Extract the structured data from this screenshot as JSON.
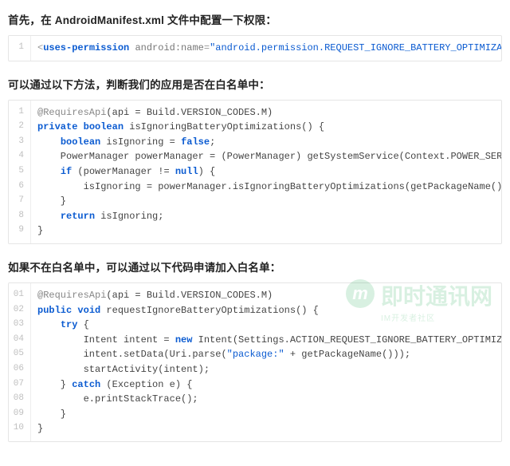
{
  "heading1": {
    "pre": "首先，在 ",
    "bold": "AndroidManifest.xml",
    "post": " 文件中配置一下权限："
  },
  "code1": {
    "lines": [
      {
        "n": "1",
        "html": "<span class='p'>&lt;</span><span class='k'>uses-permission</span> <span class='a'>android:name</span><span class='p'>=</span><span class='s'>\"android.permission.REQUEST_IGNORE_BATTERY_OPTIMIZATIONS\"</span> <span class='p'>/&gt;</span>"
      }
    ]
  },
  "heading2": "可以通过以下方法，判断我们的应用是否在白名单中：",
  "code2": {
    "lines": [
      {
        "n": "1",
        "html": "<span class='anno'>@RequiresApi</span>(api = Build.VERSION_CODES.M)"
      },
      {
        "n": "2",
        "html": "<span class='k'>private</span> <span class='k'>boolean</span> isIgnoringBatteryOptimizations() {"
      },
      {
        "n": "3",
        "html": "    <span class='k'>boolean</span> isIgnoring = <span class='k'>false</span>;"
      },
      {
        "n": "4",
        "html": "    PowerManager powerManager = (PowerManager) getSystemService(Context.POWER_SERVICE);"
      },
      {
        "n": "5",
        "html": "    <span class='k'>if</span> (powerManager != <span class='k'>null</span>) {"
      },
      {
        "n": "6",
        "html": "        isIgnoring = powerManager.isIgnoringBatteryOptimizations(getPackageName());"
      },
      {
        "n": "7",
        "html": "    }"
      },
      {
        "n": "8",
        "html": "    <span class='k'>return</span> isIgnoring;"
      },
      {
        "n": "9",
        "html": "}"
      }
    ]
  },
  "heading3": "如果不在白名单中，可以通过以下代码申请加入白名单：",
  "code3": {
    "lines": [
      {
        "n": "01",
        "html": "<span class='anno'>@RequiresApi</span>(api = Build.VERSION_CODES.M)"
      },
      {
        "n": "02",
        "html": "<span class='k'>public</span> <span class='k'>void</span> requestIgnoreBatteryOptimizations() {"
      },
      {
        "n": "03",
        "html": "    <span class='k'>try</span> {"
      },
      {
        "n": "04",
        "html": "        Intent intent = <span class='k'>new</span> Intent(Settings.ACTION_REQUEST_IGNORE_BATTERY_OPTIMIZATIONS);"
      },
      {
        "n": "05",
        "html": "        intent.setData(Uri.parse(<span class='s'>\"package:\"</span> + getPackageName()));"
      },
      {
        "n": "06",
        "html": "        startActivity(intent);"
      },
      {
        "n": "07",
        "html": "    } <span class='k'>catch</span> (Exception e) {"
      },
      {
        "n": "08",
        "html": "        e.printStackTrace();"
      },
      {
        "n": "09",
        "html": "    }"
      },
      {
        "n": "10",
        "html": "}"
      }
    ]
  },
  "watermark": {
    "icon": "m",
    "title": "即时通讯网",
    "sub": "IM开发者社区"
  }
}
